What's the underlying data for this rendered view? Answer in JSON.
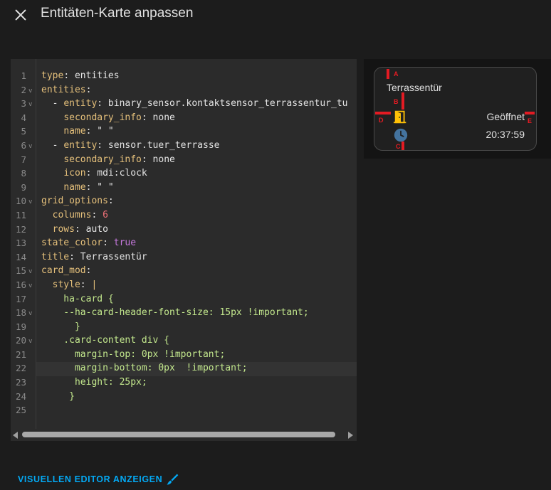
{
  "dialog": {
    "title": "Entitäten-Karte anpassen",
    "close_icon": "close-icon"
  },
  "editor": {
    "lines": [
      {
        "n": "1",
        "fold": "",
        "parts": [
          {
            "c": "k",
            "t": "type"
          },
          {
            "c": "",
            "t": ": entities"
          }
        ]
      },
      {
        "n": "2",
        "fold": "v",
        "parts": [
          {
            "c": "k",
            "t": "entities"
          },
          {
            "c": "",
            "t": ":"
          }
        ]
      },
      {
        "n": "3",
        "fold": "v",
        "parts": [
          {
            "c": "",
            "t": "  - "
          },
          {
            "c": "k",
            "t": "entity"
          },
          {
            "c": "",
            "t": ": binary_sensor.kontaktsensor_terrassentur_tu"
          }
        ]
      },
      {
        "n": "4",
        "fold": "",
        "parts": [
          {
            "c": "",
            "t": "    "
          },
          {
            "c": "k",
            "t": "secondary_info"
          },
          {
            "c": "",
            "t": ": none"
          }
        ]
      },
      {
        "n": "5",
        "fold": "",
        "parts": [
          {
            "c": "",
            "t": "    "
          },
          {
            "c": "k",
            "t": "name"
          },
          {
            "c": "",
            "t": ": \" \""
          }
        ]
      },
      {
        "n": "6",
        "fold": "v",
        "parts": [
          {
            "c": "",
            "t": "  - "
          },
          {
            "c": "k",
            "t": "entity"
          },
          {
            "c": "",
            "t": ": sensor.tuer_terrasse"
          }
        ]
      },
      {
        "n": "7",
        "fold": "",
        "parts": [
          {
            "c": "",
            "t": "    "
          },
          {
            "c": "k",
            "t": "secondary_info"
          },
          {
            "c": "",
            "t": ": none"
          }
        ]
      },
      {
        "n": "8",
        "fold": "",
        "parts": [
          {
            "c": "",
            "t": "    "
          },
          {
            "c": "k",
            "t": "icon"
          },
          {
            "c": "",
            "t": ": mdi:clock"
          }
        ]
      },
      {
        "n": "9",
        "fold": "",
        "parts": [
          {
            "c": "",
            "t": "    "
          },
          {
            "c": "k",
            "t": "name"
          },
          {
            "c": "",
            "t": ": \" \""
          }
        ]
      },
      {
        "n": "10",
        "fold": "v",
        "parts": [
          {
            "c": "k",
            "t": "grid_options"
          },
          {
            "c": "",
            "t": ":"
          }
        ]
      },
      {
        "n": "11",
        "fold": "",
        "parts": [
          {
            "c": "",
            "t": "  "
          },
          {
            "c": "k",
            "t": "columns"
          },
          {
            "c": "",
            "t": ": "
          },
          {
            "c": "n",
            "t": "6"
          }
        ]
      },
      {
        "n": "12",
        "fold": "",
        "parts": [
          {
            "c": "",
            "t": "  "
          },
          {
            "c": "k",
            "t": "rows"
          },
          {
            "c": "",
            "t": ": auto"
          }
        ]
      },
      {
        "n": "13",
        "fold": "",
        "parts": [
          {
            "c": "k",
            "t": "state_color"
          },
          {
            "c": "",
            "t": ": "
          },
          {
            "c": "b",
            "t": "true"
          }
        ]
      },
      {
        "n": "14",
        "fold": "",
        "parts": [
          {
            "c": "k",
            "t": "title"
          },
          {
            "c": "",
            "t": ": Terrassentür"
          }
        ]
      },
      {
        "n": "15",
        "fold": "v",
        "parts": [
          {
            "c": "k",
            "t": "card_mod"
          },
          {
            "c": "",
            "t": ":"
          }
        ]
      },
      {
        "n": "16",
        "fold": "v",
        "parts": [
          {
            "c": "",
            "t": "  "
          },
          {
            "c": "k",
            "t": "style"
          },
          {
            "c": "",
            "t": ": "
          },
          {
            "c": "k",
            "t": "|"
          }
        ]
      },
      {
        "n": "17",
        "fold": "",
        "parts": [
          {
            "c": "g",
            "t": "    ha-card {"
          }
        ]
      },
      {
        "n": "18",
        "fold": "v",
        "parts": [
          {
            "c": "g",
            "t": "    --ha-card-header-font-size: 15px !important;"
          }
        ]
      },
      {
        "n": "19",
        "fold": "",
        "parts": [
          {
            "c": "g",
            "t": "      }"
          }
        ]
      },
      {
        "n": "20",
        "fold": "v",
        "parts": [
          {
            "c": "g",
            "t": "    .card-content div {"
          }
        ]
      },
      {
        "n": "21",
        "fold": "",
        "parts": [
          {
            "c": "g",
            "t": "      margin-top: 0px !important;"
          }
        ]
      },
      {
        "n": "22",
        "fold": "",
        "parts": [
          {
            "c": "g",
            "t": "      margin-bottom: 0px  !important;"
          }
        ]
      },
      {
        "n": "23",
        "fold": "",
        "parts": [
          {
            "c": "g",
            "t": "      height: 25px;"
          }
        ]
      },
      {
        "n": "24",
        "fold": "",
        "parts": [
          {
            "c": "g",
            "t": "     }"
          }
        ]
      },
      {
        "n": "25",
        "fold": "",
        "parts": []
      }
    ]
  },
  "preview": {
    "card_title": "Terrassentür",
    "rows": [
      {
        "icon": "door-open-icon",
        "state": "Geöffnet"
      },
      {
        "icon": "clock-icon",
        "state": "20:37:59"
      }
    ],
    "markers": [
      "A",
      "B",
      "C",
      "D",
      "E"
    ]
  },
  "footer": {
    "visual_editor_label": "VISUELLEN EDITOR ANZEIGEN",
    "icon": "brush-icon"
  },
  "colors": {
    "accent": "#03a9f4",
    "door_icon": "#ffc107",
    "clock_icon": "#44739e",
    "marker": "#e31b23"
  }
}
